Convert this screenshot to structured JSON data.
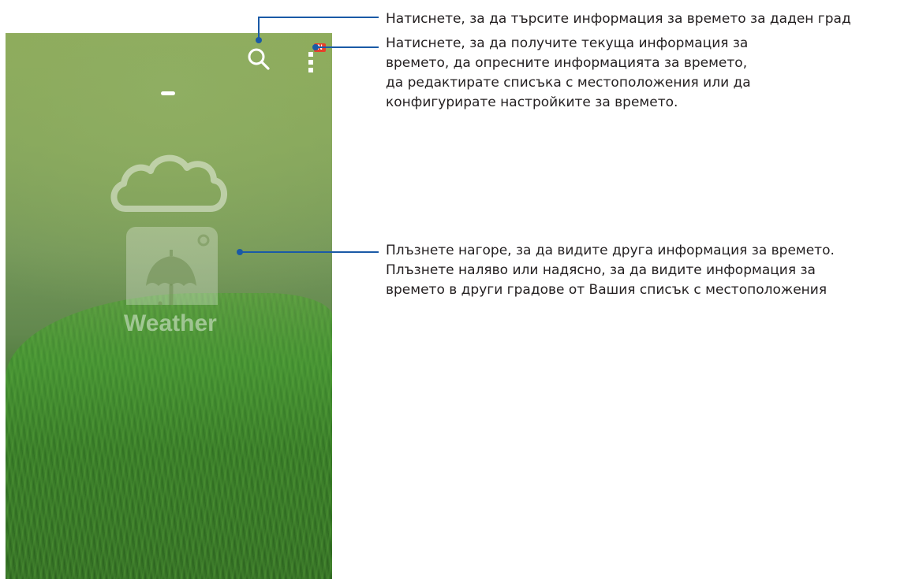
{
  "app": {
    "logo_text": "Weather",
    "badge": "N"
  },
  "icons": {
    "search": "search-icon",
    "menu": "overflow-menu-icon",
    "logo": "weather-umbrella-cloud-icon"
  },
  "annotations": {
    "search": [
      "Натиснете, за да търсите информация за времето за даден град"
    ],
    "menu": [
      "Натиснете, за да получите текуща информация за",
      "времето, да опресните информацията за времето,",
      "да редактирате списъка с местоположения или да",
      "конфигурирате настройките за времето."
    ],
    "swipe": [
      "Плъзнете нагоре, за да видите друга информация за времето.",
      "Плъзнете наляво или надясно, за да видите информация за",
      "времето в други градове от Вашия списък с местоположения"
    ]
  },
  "colors": {
    "callout_line": "#1a5aa6",
    "badge": "#e8402b",
    "text": "#231f20"
  }
}
